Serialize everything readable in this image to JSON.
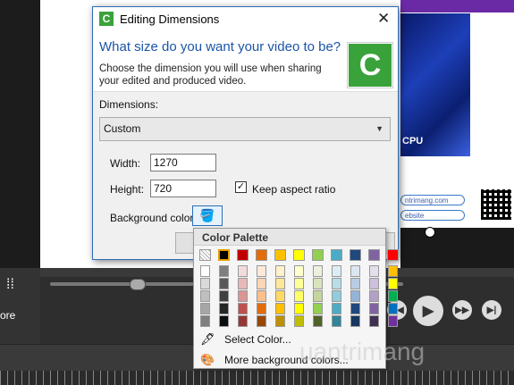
{
  "background_app": {
    "more_label": "ore",
    "cpu_label": "CPU",
    "pill_1": "ntrimang.com",
    "pill_2": "ebsite"
  },
  "dialog": {
    "title": "Editing Dimensions",
    "headline": "What size do you want your video to be?",
    "subtext": "Choose the dimension you will use when sharing your edited and produced video.",
    "dimensions_label": "Dimensions:",
    "dimensions_value": "Custom",
    "width_label": "Width:",
    "width_value": "1270",
    "height_label": "Height:",
    "height_value": "720",
    "keep_aspect_label": "Keep aspect ratio",
    "keep_aspect_checked": true,
    "background_color_label": "Background color:"
  },
  "palette": {
    "title": "Color Palette",
    "top_row": [
      "transparent",
      "#000000",
      "#c00000",
      "#e46c0a",
      "#ffc000",
      "#ffff00",
      "#92d050",
      "#4bacc6",
      "#1f497d",
      "#8064a2",
      "#ff0000"
    ],
    "columns": [
      [
        "#ffffff",
        "#d9d9d9",
        "#bfbfbf",
        "#a6a6a6",
        "#7f7f7f"
      ],
      [
        "#7f7f7f",
        "#595959",
        "#404040",
        "#262626",
        "#0d0d0d"
      ],
      [
        "#f2dcdb",
        "#e6b9b8",
        "#d99694",
        "#c0504d",
        "#953735"
      ],
      [
        "#fde9d9",
        "#fcd5b4",
        "#fabf8f",
        "#e46c0a",
        "#974806"
      ],
      [
        "#fff2cc",
        "#ffe699",
        "#ffd966",
        "#ffc000",
        "#bf9000"
      ],
      [
        "#ffffcc",
        "#ffff99",
        "#ffff66",
        "#ffff00",
        "#bfbf00"
      ],
      [
        "#ebf1de",
        "#d7e4bc",
        "#c3d69b",
        "#92d050",
        "#4f6228"
      ],
      [
        "#dbeef3",
        "#b7dee8",
        "#92cddc",
        "#4bacc6",
        "#31859b"
      ],
      [
        "#dce6f1",
        "#b8cce4",
        "#95b3d7",
        "#1f497d",
        "#17375e"
      ],
      [
        "#e4dfec",
        "#ccc0da",
        "#b2a1c7",
        "#8064a2",
        "#3f3151"
      ],
      [
        "#ffc000",
        "#ffff00",
        "#00b050",
        "#0070c0",
        "#7030a0"
      ]
    ],
    "select_color_label": "Select Color...",
    "more_bg_label": "More background colors..."
  },
  "watermark": "uantrimang"
}
